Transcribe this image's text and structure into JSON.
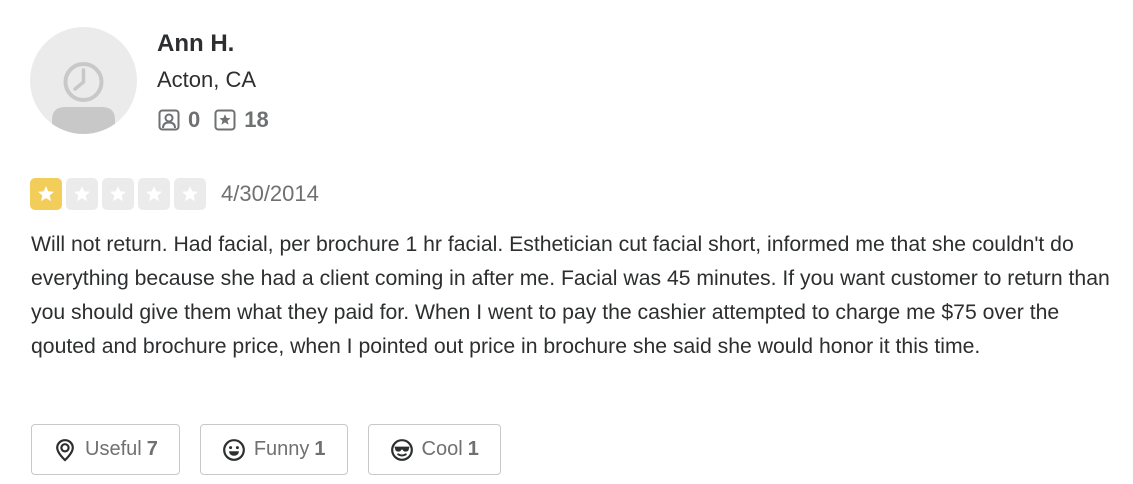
{
  "reviewer": {
    "name": "Ann H.",
    "location": "Acton, CA",
    "friends_count": "0",
    "reviews_count": "18",
    "avatar_icon": "default-user-avatar-icon"
  },
  "review": {
    "rating": 1,
    "rating_max": 5,
    "date": "4/30/2014",
    "text": "Will not return. Had facial, per brochure 1 hr facial. Esthetician cut facial short, informed me that she couldn't do everything because she had a client coming in after me. Facial was 45 minutes. If you want customer to return than you should give them what they paid for. When I went to pay the cashier attempted to charge me $75 over the qouted and brochure price, when I pointed out price in brochure she said she would honor it this time."
  },
  "reactions": {
    "useful": {
      "label": "Useful",
      "count": "7",
      "icon": "lightbulb-icon"
    },
    "funny": {
      "label": "Funny",
      "count": "1",
      "icon": "smile-icon"
    },
    "cool": {
      "label": "Cool",
      "count": "1",
      "icon": "sunglasses-icon"
    }
  },
  "colors": {
    "star_filled": "#f2cd5a",
    "star_empty": "#ebebeb",
    "text_primary": "#2d2e2f",
    "text_secondary": "#6e7072",
    "button_border": "#c8c9ca"
  }
}
